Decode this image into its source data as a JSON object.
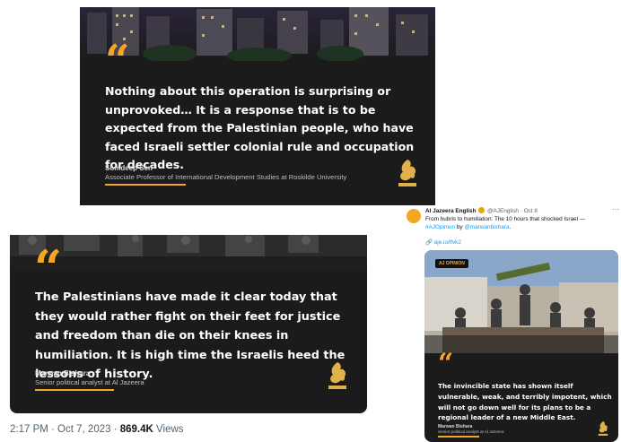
{
  "colors": {
    "accent": "#f5a623",
    "card_bg": "#1b1b1b",
    "link": "#1d9bf0"
  },
  "card1": {
    "quote_mark": "“",
    "quote": "Nothing about this operation is surprising or unprovoked… It is a response that is to be expected from the Palestinian people, who have faced Israeli settler colonial rule and occupation for decades.",
    "author": "Somdeep Sen",
    "role": "Associate Professor of International Development Studies at Roskilde University",
    "logo_icon": "al-jazeera-logo-icon"
  },
  "card2": {
    "quote_mark": "“",
    "quote": "The Palestinians have made it clear today that they would rather fight on their feet for justice and freedom than die on their knees in humiliation. It is high time the Israelis heed the lessons of history.",
    "author": "Marwan Bishara",
    "role": "Senior political analyst at Al Jazeera",
    "logo_icon": "al-jazeera-logo-icon"
  },
  "tweet_meta": {
    "time": "2:17 PM · Oct 7, 2023",
    "separator": " · ",
    "views_count": "869.4K",
    "views_label": "Views"
  },
  "tweet": {
    "account_name": "Al Jazeera English",
    "handle_date": "@AJEnglish · Oct 8",
    "more": "···",
    "body_start": "From hubris to humiliation: The 10 hours that shocked Israel — ",
    "hashtag": "#AJOpinion",
    "body_by": "by ",
    "mention": "@marwanbishara",
    "body_end": ".",
    "url": "🔗 aje.io/lfvk2",
    "card": {
      "tag": "AJ OPINION",
      "quote_mark": "“",
      "quote": "The invincible state has shown itself vulnerable, weak, and terribly impotent, which will not go down well for its plans to be a regional leader of a new Middle East.",
      "author": "Marwan Bishara",
      "role": "Senior political analyst at Al Jazeera",
      "logo_icon": "al-jazeera-logo-icon"
    }
  }
}
